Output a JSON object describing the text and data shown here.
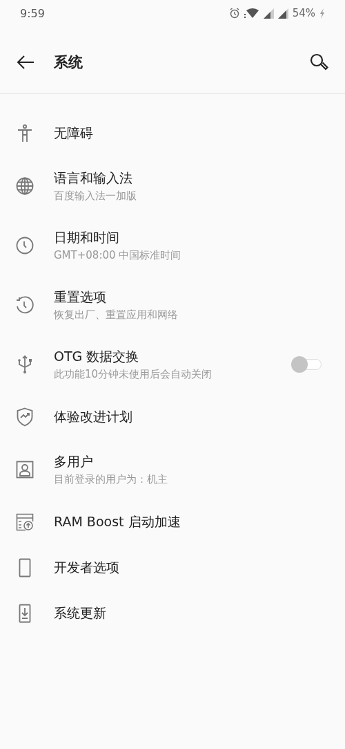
{
  "status_bar": {
    "time": "9:59",
    "battery": "54%"
  },
  "toolbar": {
    "title": "系统"
  },
  "items": [
    {
      "title": "无障碍"
    },
    {
      "title": "语言和输入法",
      "subtitle": "百度输入法一加版"
    },
    {
      "title": "日期和时间",
      "subtitle": "GMT+08:00 中国标准时间"
    },
    {
      "title": "重置选项",
      "subtitle": "恢复出厂、重置应用和网络"
    },
    {
      "title": "OTG 数据交换",
      "subtitle": "此功能10分钟未使用后会自动关闭",
      "switch": {
        "on": false
      }
    },
    {
      "title": "体验改进计划"
    },
    {
      "title": "多用户",
      "subtitle": "目前登录的用户为：机主"
    },
    {
      "title": "RAM Boost 启动加速"
    },
    {
      "title": "开发者选项"
    },
    {
      "title": "系统更新"
    }
  ]
}
